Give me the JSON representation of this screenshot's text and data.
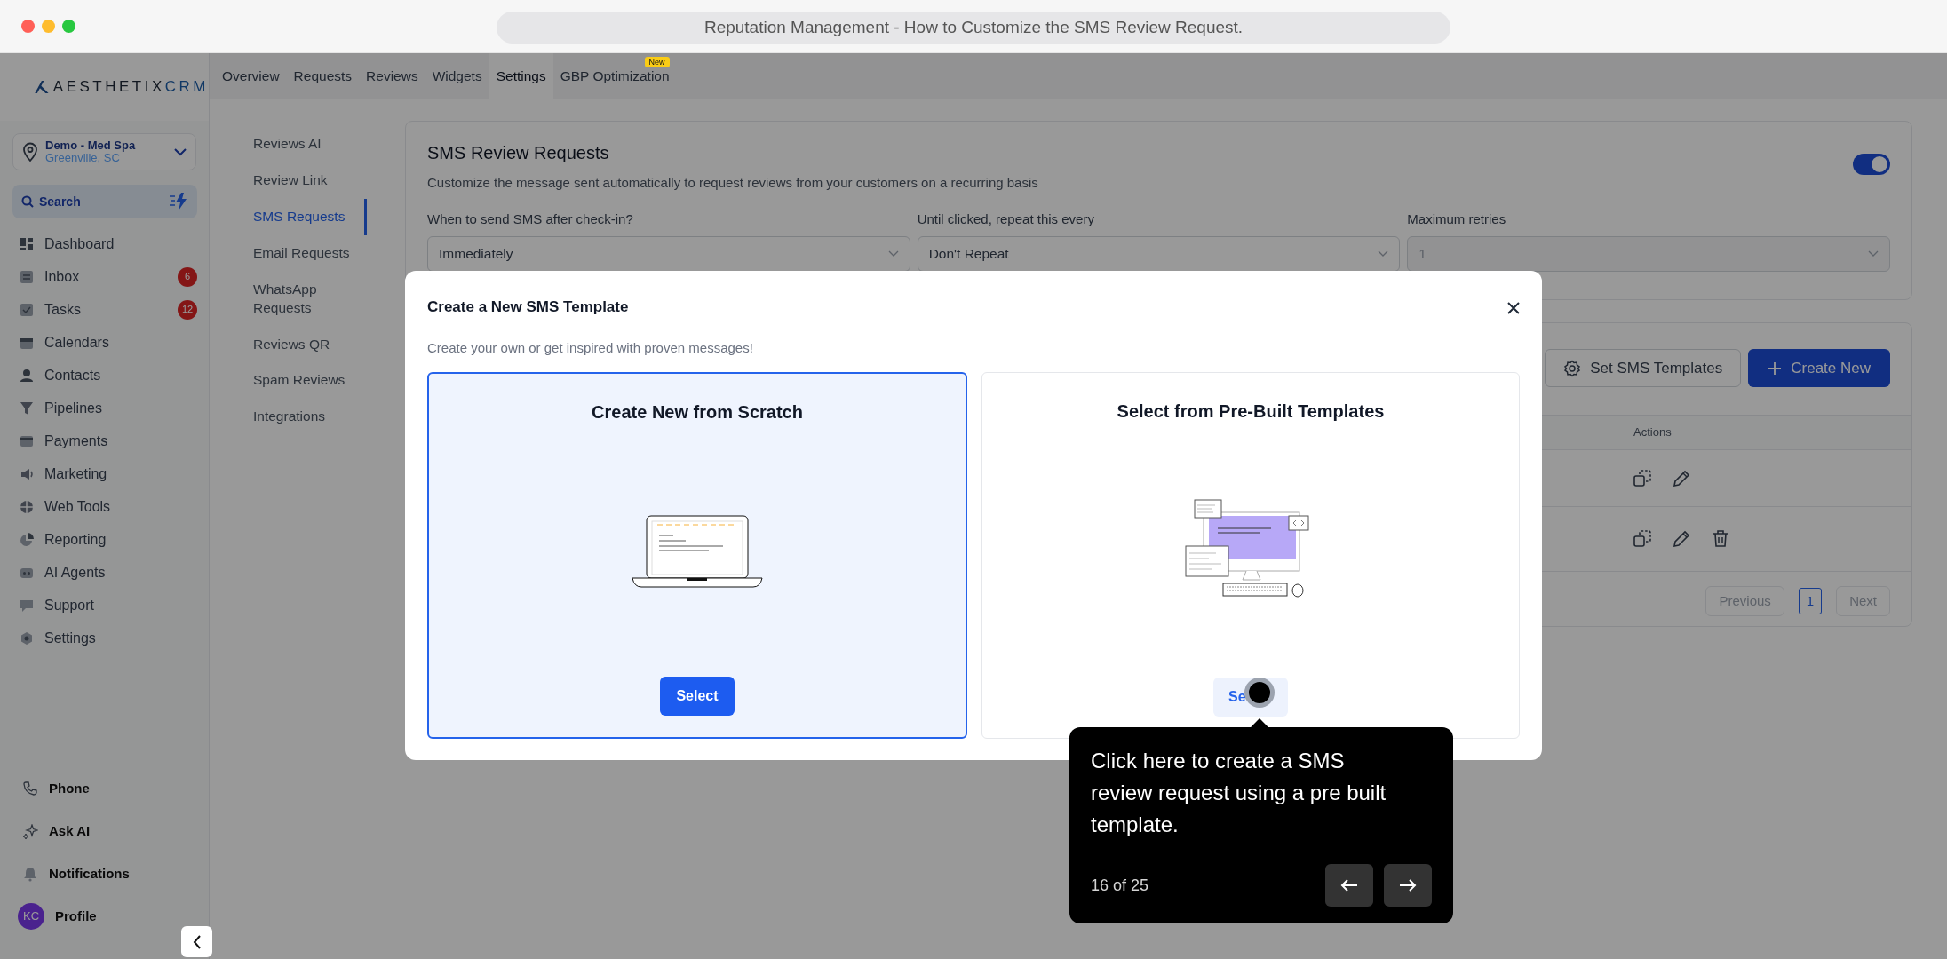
{
  "browser": {
    "title": "Reputation Management - How to Customize the SMS Review Request."
  },
  "logo": {
    "name": "AESTHETIX",
    "suffix": "CRM"
  },
  "location": {
    "name": "Demo - Med Spa",
    "city": "Greenville, SC"
  },
  "search": {
    "label": "Search"
  },
  "nav": [
    {
      "label": "Dashboard"
    },
    {
      "label": "Inbox",
      "badge": "6"
    },
    {
      "label": "Tasks",
      "badge": "12"
    },
    {
      "label": "Calendars"
    },
    {
      "label": "Contacts"
    },
    {
      "label": "Pipelines"
    },
    {
      "label": "Payments"
    },
    {
      "label": "Marketing"
    },
    {
      "label": "Web Tools"
    },
    {
      "label": "Reporting"
    },
    {
      "label": "AI Agents"
    },
    {
      "label": "Support"
    },
    {
      "label": "Settings"
    }
  ],
  "footer_nav": [
    {
      "kind": "phone",
      "label": "Phone"
    },
    {
      "kind": "ai",
      "label": "Ask AI"
    },
    {
      "kind": "bell",
      "label": "Notifications"
    },
    {
      "kind": "profile",
      "label": "Profile",
      "avatar": "KC"
    }
  ],
  "tabs": [
    {
      "label": "Overview",
      "selected": false
    },
    {
      "label": "Requests",
      "selected": false
    },
    {
      "label": "Reviews",
      "selected": false
    },
    {
      "label": "Widgets",
      "selected": false
    },
    {
      "label": "Settings",
      "selected": true
    },
    {
      "label": "GBP Optimization",
      "selected": false,
      "badge": "New"
    }
  ],
  "settings_menu": [
    {
      "label": "Reviews AI",
      "selected": false
    },
    {
      "label": "Review Link",
      "selected": false
    },
    {
      "label": "SMS Requests",
      "selected": true
    },
    {
      "label": "Email Requests",
      "selected": false
    },
    {
      "label": "WhatsApp Requests",
      "selected": false
    },
    {
      "label": "Reviews QR",
      "selected": false
    },
    {
      "label": "Spam Reviews",
      "selected": false
    },
    {
      "label": "Integrations",
      "selected": false
    }
  ],
  "sms_settings": {
    "title": "SMS Review Requests",
    "description": "Customize the message sent automatically to request reviews from your customers on a recurring basis",
    "enabled": true,
    "fields": [
      {
        "label": "When to send SMS after check-in?",
        "value": "Immediately",
        "disabled": false
      },
      {
        "label": "Until clicked, repeat this every",
        "value": "Don't Repeat",
        "disabled": false
      },
      {
        "label": "Maximum retries",
        "value": "1",
        "disabled": true
      }
    ]
  },
  "templates": {
    "buttons": [
      {
        "kind": "settings",
        "label": "Set SMS Templates"
      },
      {
        "kind": "create",
        "label": "Create New"
      }
    ],
    "actions_header": "Actions",
    "rows": [
      {
        "deletable": false
      },
      {
        "deletable": true
      }
    ],
    "pagination": {
      "previous": "Previous",
      "pages": [
        {
          "label": "1",
          "selected": true
        }
      ],
      "next": "Next"
    }
  },
  "modal": {
    "title": "Create a New SMS Template",
    "subtitle": "Create your own or get inspired with proven messages!",
    "options": [
      {
        "kind": "scratch",
        "title": "Create New from Scratch",
        "button": "Select",
        "selected": true
      },
      {
        "kind": "prebuilt",
        "title": "Select from Pre-Built Templates",
        "button": "Se",
        "selected": false
      }
    ]
  },
  "tour": {
    "text": "Click here to create a SMS review request using a pre built template.",
    "progress": "16 of 25"
  }
}
